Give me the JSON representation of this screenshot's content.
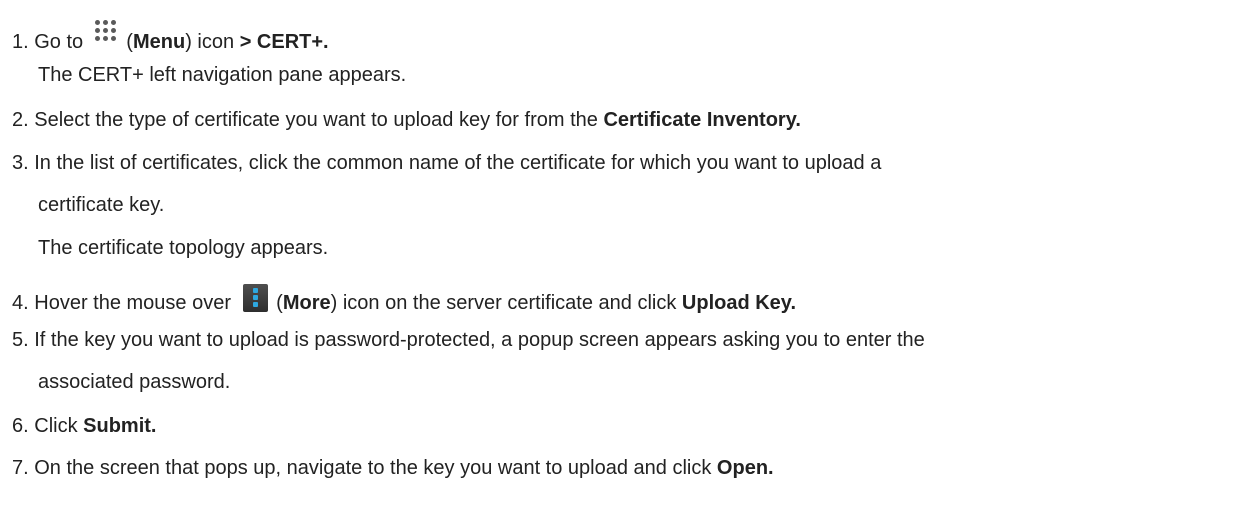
{
  "steps": [
    {
      "num": "1.",
      "t1": "Go to",
      "paren_open": "(",
      "menu": "Menu",
      "paren_close": ")",
      "t2": "icon",
      "bold": "> CERT+.",
      "note": "The CERT+ left navigation pane appears."
    },
    {
      "num": "2.",
      "text": "Select the type of certificate you want to upload key for from the",
      "bold": "Certificate Inventory."
    },
    {
      "num": "3.",
      "line1": "In the list of certificates, click the common name of the certificate for which you want to upload a",
      "line2": "certificate key.",
      "note": "The certificate topology appears."
    },
    {
      "num": "4.",
      "t1": "Hover the mouse over",
      "paren_open": "(",
      "more": "More",
      "paren_close": ")",
      "t2": "icon on the server certificate and click",
      "bold": "Upload Key."
    },
    {
      "num": "5.",
      "line1": "If the key you want to upload is password-protected, a popup screen appears asking you to enter the",
      "line2": "associated password."
    },
    {
      "num": "6.",
      "text": "Click",
      "bold": "Submit."
    },
    {
      "num": "7.",
      "text": "On the screen that pops up, navigate to the key you want to upload and click",
      "bold": "Open."
    }
  ],
  "icons": {
    "menu": "grid-menu-icon",
    "more": "vertical-ellipsis-icon",
    "more_accent": "#2ea8e0"
  }
}
